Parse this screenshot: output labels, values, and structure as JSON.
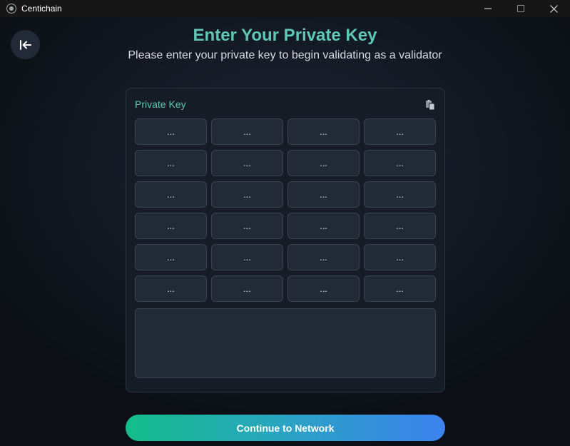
{
  "window": {
    "title": "Centichain",
    "logo_icon": "centichain-logo-icon",
    "controls": [
      "minimize-icon",
      "maximize-icon",
      "close-icon"
    ]
  },
  "header": {
    "back_icon": "arrow-left-to-line-icon",
    "title": "Enter Your Private Key",
    "subtitle": "Please enter your private key to begin validating as a validator"
  },
  "private_key": {
    "label": "Private Key",
    "paste_icon": "paste-icon",
    "word_placeholder": "...",
    "words": [
      "",
      "",
      "",
      "",
      "",
      "",
      "",
      "",
      "",
      "",
      "",
      "",
      "",
      "",
      "",
      "",
      "",
      "",
      "",
      "",
      "",
      "",
      "",
      ""
    ],
    "textarea_value": ""
  },
  "actions": {
    "continue_label": "Continue to Network"
  },
  "colors": {
    "accent": "#5fc7b6",
    "button_gradient_start": "#14bd8a",
    "button_gradient_end": "#3c82ef",
    "background": "#131923"
  }
}
